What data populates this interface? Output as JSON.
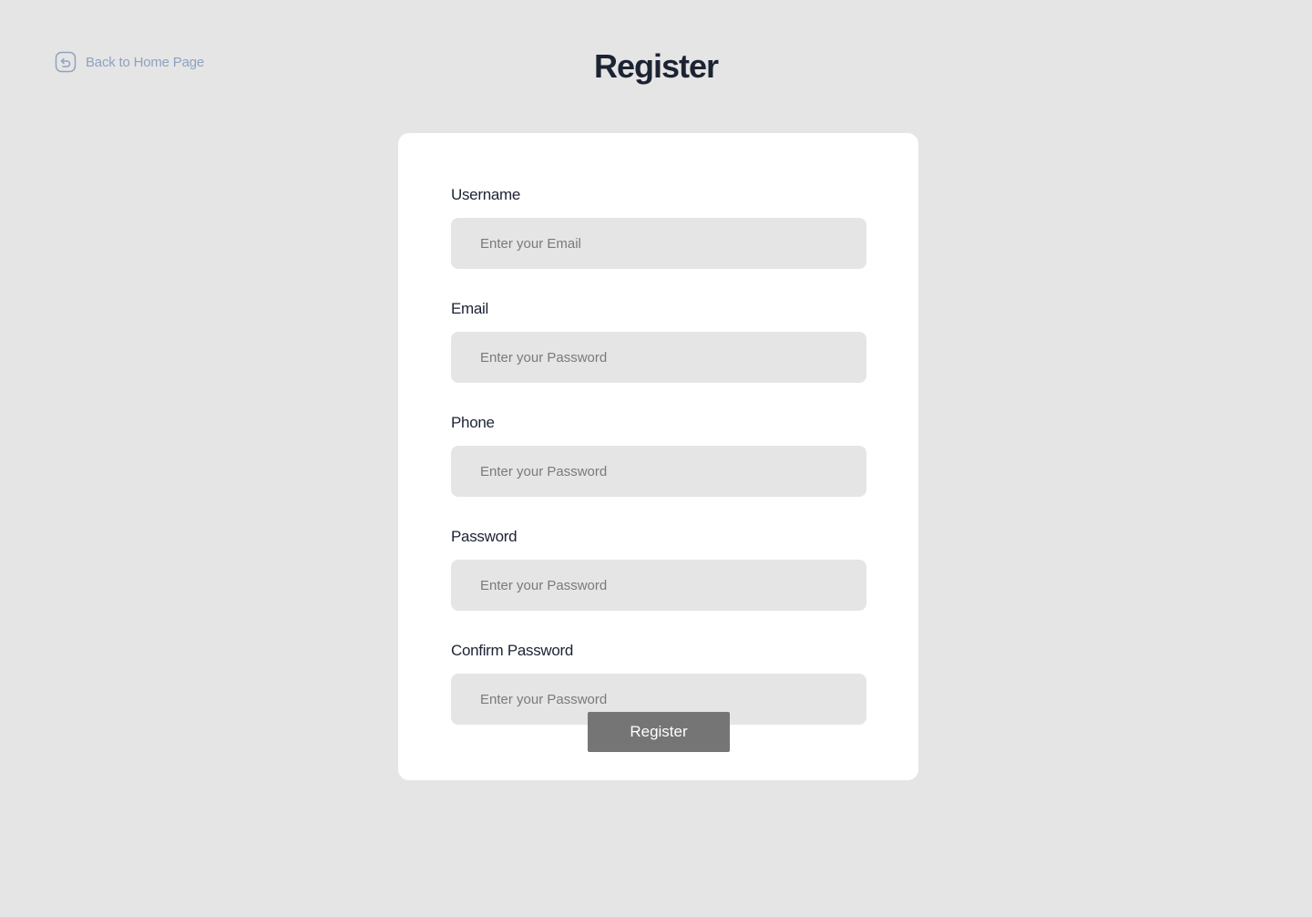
{
  "header": {
    "back_label": "Back to Home Page",
    "back_icon": "back-arrow-icon",
    "title": "Register"
  },
  "form": {
    "fields": [
      {
        "label": "Username",
        "placeholder": "Enter your Email"
      },
      {
        "label": "Email",
        "placeholder": "Enter your Password"
      },
      {
        "label": "Phone",
        "placeholder": "Enter your Password"
      },
      {
        "label": "Password",
        "placeholder": "Enter your Password"
      },
      {
        "label": "Confirm Password",
        "placeholder": "Enter your Password"
      }
    ],
    "submit_label": "Register"
  },
  "colors": {
    "background": "#e5e5e5",
    "card": "#ffffff",
    "title": "#1c2333",
    "back_link": "#8ea2c0",
    "button": "#757575",
    "input_bg": "#e5e5e5"
  }
}
